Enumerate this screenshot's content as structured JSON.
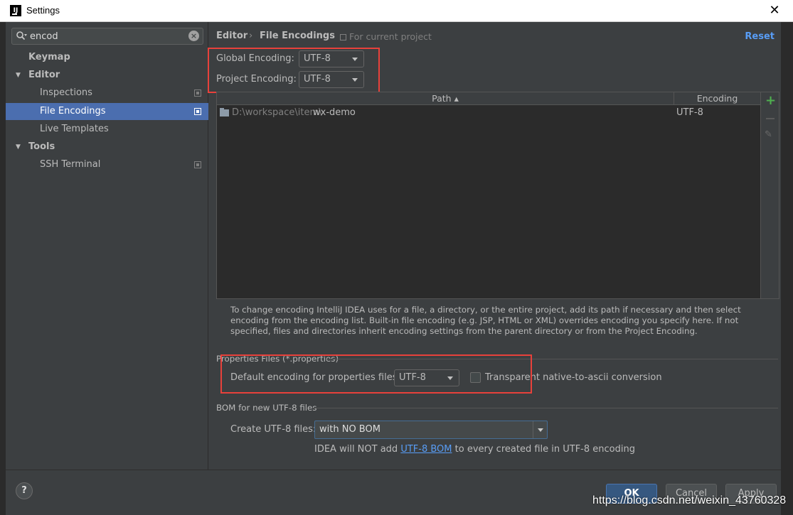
{
  "window": {
    "title": "Settings",
    "app_icon_text": "IJ"
  },
  "search": {
    "value": "encod"
  },
  "sidebar": {
    "items": [
      {
        "label": "Keymap"
      },
      {
        "label": "Editor"
      },
      {
        "label": "Inspections"
      },
      {
        "label": "File Encodings"
      },
      {
        "label": "Live Templates"
      },
      {
        "label": "Tools"
      },
      {
        "label": "SSH Terminal"
      }
    ]
  },
  "header": {
    "crumb_root": "Editor",
    "crumb_sep": "›",
    "crumb_page": "File Encodings",
    "scope": "For current project",
    "reset": "Reset"
  },
  "encodings": {
    "global_label": "Global Encoding:",
    "global_value": "UTF-8",
    "project_label": "Project Encoding:",
    "project_value": "UTF-8"
  },
  "table": {
    "columns": [
      "Path ▴",
      "Encoding"
    ],
    "rows": [
      {
        "path_prefix": "D:\\workspace\\item\\",
        "path_name": "wx-demo",
        "encoding": "UTF-8"
      }
    ]
  },
  "help_text": "To change encoding IntelliJ IDEA uses for a file, a directory, or the entire project, add its path if necessary and then select encoding from the encoding list. Built-in file encoding (e.g. JSP, HTML or XML) overrides encoding you specify here. If not specified, files and directories inherit encoding settings from the parent directory or from the Project Encoding.",
  "properties": {
    "section_title": "Properties Files (*.properties)",
    "default_label": "Default encoding for properties files:",
    "default_value": "UTF-8",
    "transparent_label": "Transparent native-to-ascii conversion",
    "transparent_checked": false
  },
  "bom": {
    "section_title": "BOM for new UTF-8 files",
    "create_label": "Create UTF-8 files:",
    "create_value": "with NO BOM",
    "note_before": "IDEA will NOT add ",
    "note_link": "UTF-8 BOM",
    "note_after": " to every created file in UTF-8 encoding"
  },
  "buttons": {
    "help": "?",
    "ok": "OK",
    "cancel": "Cancel",
    "apply": "Apply"
  },
  "watermark": "https://blog.csdn.net/weixin_43760328",
  "colors": {
    "highlight": "#e8413b",
    "selection": "#4b6eaf",
    "link": "#589df6",
    "add": "#4fb04f"
  }
}
